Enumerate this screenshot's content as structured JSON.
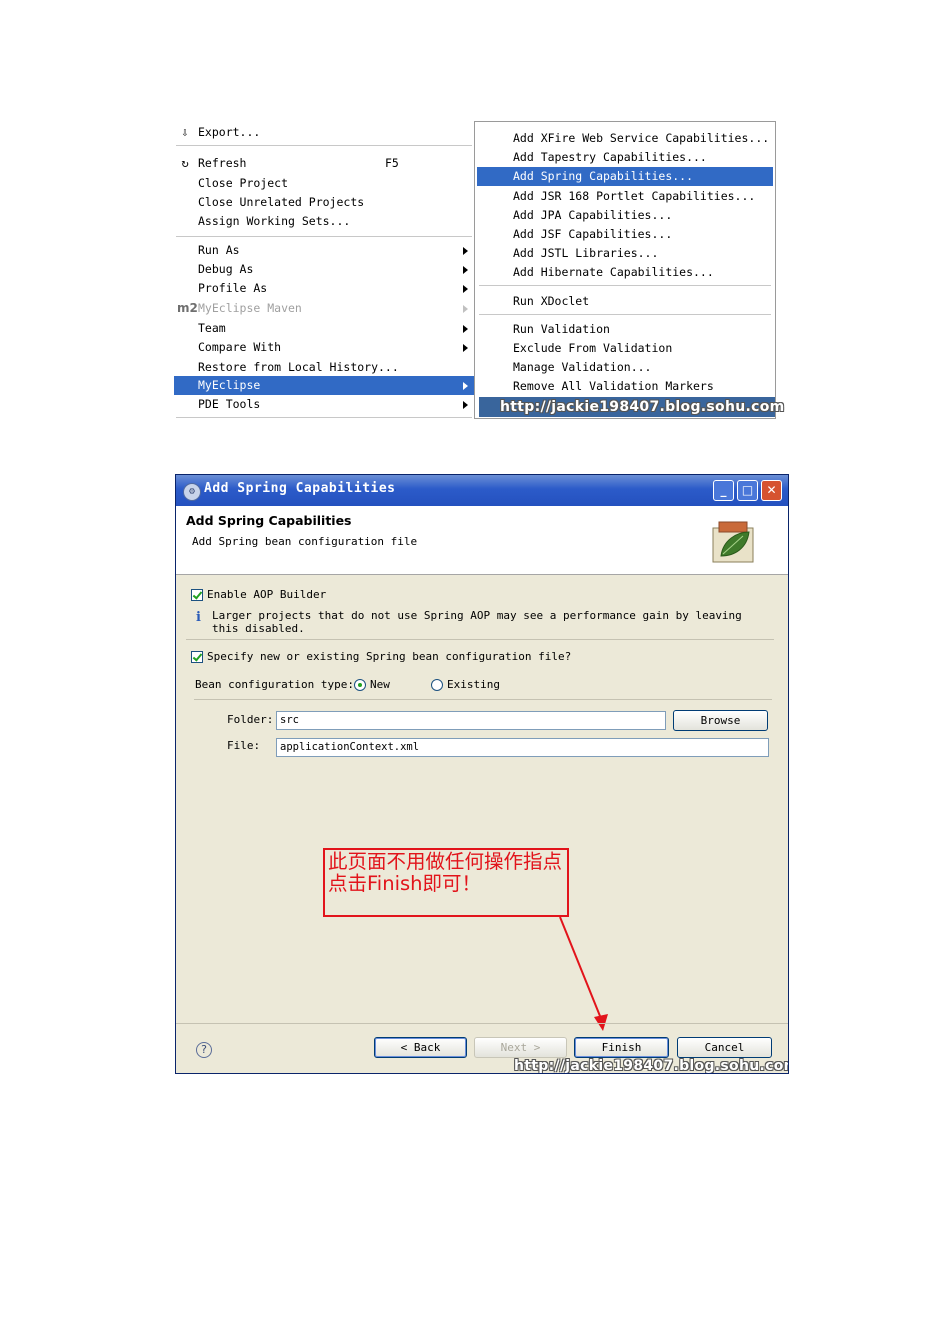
{
  "context_menu": {
    "items": [
      {
        "label": "Export...",
        "icon": "export-icon"
      },
      {
        "label": "Refresh",
        "accelerator": "F5",
        "icon": "refresh-icon"
      },
      {
        "label": "Close Project"
      },
      {
        "label": "Close Unrelated Projects"
      },
      {
        "label": "Assign Working Sets..."
      },
      {
        "label": "Run As"
      },
      {
        "label": "Debug As"
      },
      {
        "label": "Profile As"
      },
      {
        "label": "MyEclipse Maven",
        "icon_text": "m2"
      },
      {
        "label": "Team"
      },
      {
        "label": "Compare With"
      },
      {
        "label": "Restore from Local History..."
      },
      {
        "label": "MyEclipse"
      },
      {
        "label": "PDE Tools"
      }
    ],
    "submenu": [
      "Add XFire Web Service Capabilities...",
      "Add Tapestry Capabilities...",
      "Add Spring Capabilities...",
      "Add JSR 168 Portlet Capabilities...",
      "Add JPA Capabilities...",
      "Add JSF Capabilities...",
      "Add JSTL Libraries...",
      "Add Hibernate Capabilities...",
      "Run XDoclet",
      "Run Validation",
      "Exclude From Validation",
      "Manage Validation...",
      "Remove All Validation Markers"
    ],
    "selected_item": "MyEclipse",
    "selected_submenu_item": "Add Spring Capabilities...",
    "selection_color": "#316ac5",
    "watermark": "http://jackie198407.blog.sohu.com"
  },
  "dialog": {
    "title": "Add Spring Capabilities",
    "header_title": "Add Spring Capabilities",
    "header_subtitle": "Add Spring bean configuration file",
    "aop_checkbox_label": "Enable AOP Builder",
    "aop_info": "Larger projects that do not use Spring AOP may see a performance gain by leaving this disabled.",
    "specify_checkbox_label": "Specify new or existing Spring bean configuration file?",
    "bean_type_label": "Bean configuration type:",
    "radio_new": "New",
    "radio_existing": "Existing",
    "folder_label": "Folder:",
    "folder_value": "src",
    "browse_label": "Browse",
    "file_label": "File:",
    "file_value": "applicationContext.xml",
    "buttons": {
      "back": "< Back",
      "next": "Next >",
      "finish": "Finish",
      "cancel": "Cancel"
    },
    "annotation": "此页面不用做任何操作指点点击Finish即可！",
    "annotation_color": "#e2141b",
    "watermark": "http://jackie198407.blog.sohu.com"
  }
}
